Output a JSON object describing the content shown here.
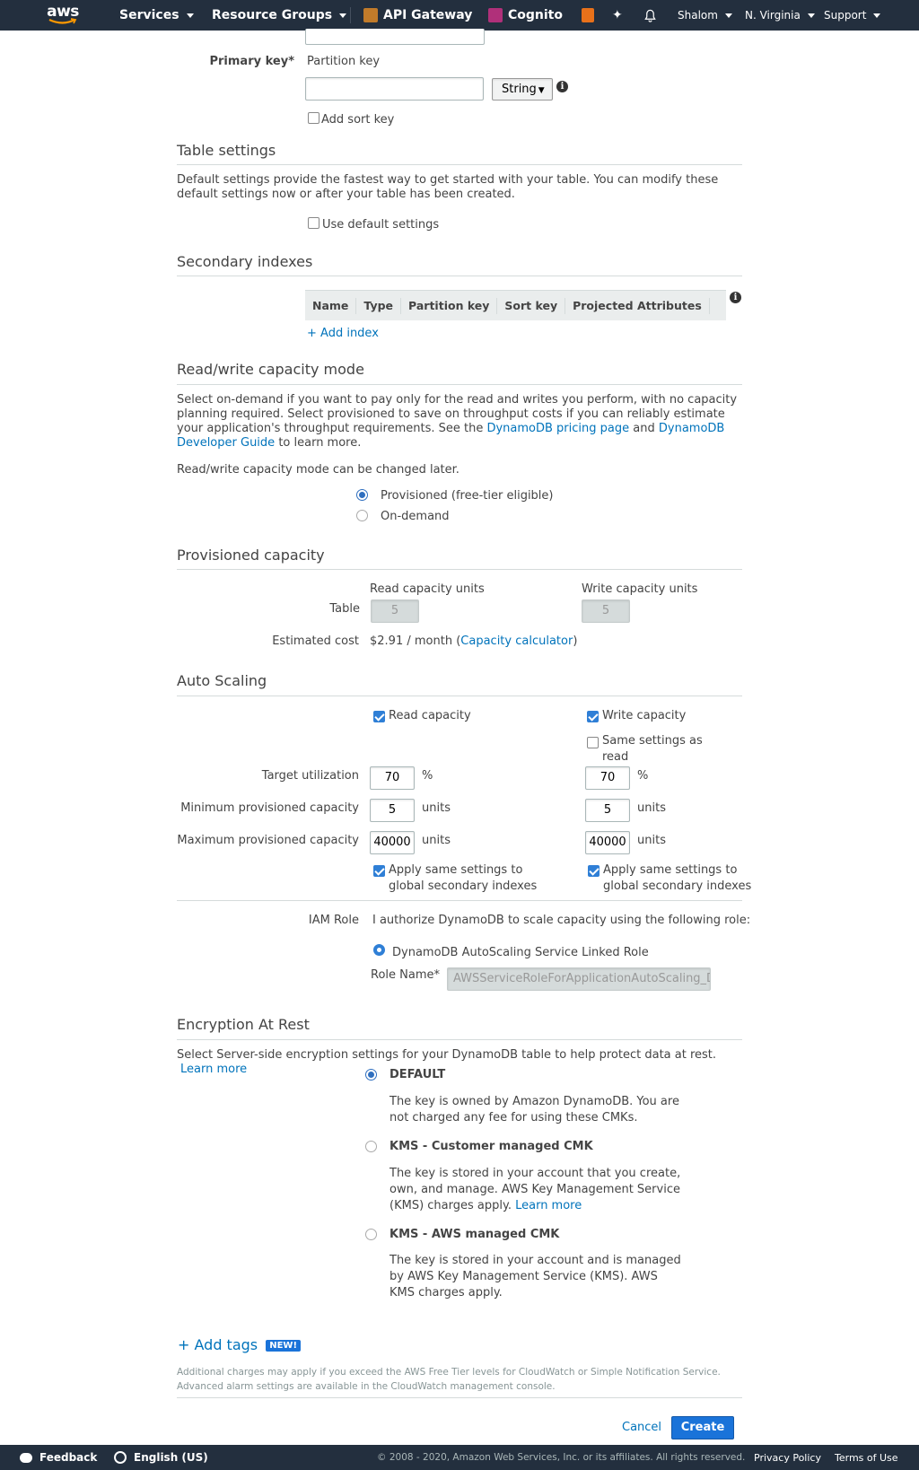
{
  "nav": {
    "logo_text": "aws",
    "services": "Services",
    "resource_groups": "Resource Groups",
    "api_gateway": "API Gateway",
    "cognito": "Cognito",
    "user": "Shalom",
    "region": "N. Virginia",
    "support": "Support"
  },
  "primary_key": {
    "label": "Primary key*",
    "partition_label": "Partition key",
    "partition_value": "",
    "type_value": "String",
    "add_sort_key": "Add sort key"
  },
  "table_settings": {
    "title": "Table settings",
    "description": "Default settings provide the fastest way to get started with your table. You can modify these default settings now or after your table has been created.",
    "use_default": "Use default settings"
  },
  "secondary_indexes": {
    "title": "Secondary indexes",
    "columns": [
      "Name",
      "Type",
      "Partition key",
      "Sort key",
      "Projected Attributes"
    ],
    "add_index": "+ Add index"
  },
  "capacity_mode": {
    "title": "Read/write capacity mode",
    "desc_part1": "Select on-demand if you want to pay only for the read and writes you perform, with no capacity planning required. Select provisioned to save on throughput costs if you can reliably estimate your application's throughput requirements. See the",
    "pricing_link": "DynamoDB pricing page",
    "and": "and",
    "guide_link": "DynamoDB Developer Guide",
    "desc_part2": "to learn more.",
    "change_later": "Read/write capacity mode can be changed later.",
    "provisioned": "Provisioned (free-tier eligible)",
    "on_demand": "On-demand"
  },
  "provisioned_capacity": {
    "title": "Provisioned capacity",
    "read_units_label": "Read capacity units",
    "write_units_label": "Write capacity units",
    "table_label": "Table",
    "read_value": "5",
    "write_value": "5",
    "estimated_cost_label": "Estimated cost",
    "cost": "$2.91 / month",
    "calc_open": "(",
    "calculator_link": "Capacity calculator",
    "calc_close": ")"
  },
  "auto_scaling": {
    "title": "Auto Scaling",
    "read_capacity": "Read capacity",
    "write_capacity": "Write capacity",
    "same_settings_line1": "Same settings as",
    "same_settings_line2": "read",
    "target_label": "Target utilization",
    "min_label": "Minimum provisioned capacity",
    "max_label": "Maximum provisioned capacity",
    "read_target": "70",
    "write_target": "70",
    "read_min": "5",
    "write_min": "5",
    "read_max": "40000",
    "write_max": "40000",
    "percent": "%",
    "units": "units",
    "apply_line1": "Apply same settings to",
    "apply_line2": "global secondary indexes",
    "iam_label": "IAM Role",
    "iam_desc": "I authorize DynamoDB to scale capacity using the following role:",
    "linked_role": "DynamoDB AutoScaling Service Linked Role",
    "role_name_label": "Role Name*",
    "role_name_value": "AWSServiceRoleForApplicationAutoScaling_D"
  },
  "encryption": {
    "title": "Encryption At Rest",
    "desc": "Select Server-side encryption settings for your DynamoDB table to help protect data at rest.",
    "learn_more": "Learn more",
    "default_title": "DEFAULT",
    "default_desc_1": "The key is owned by Amazon DynamoDB. You are",
    "default_desc_2": "not charged any fee for using these CMKs.",
    "kms_customer_title": "KMS - Customer managed CMK",
    "kms_customer_desc_1": "The key is stored in your account that you create,",
    "kms_customer_desc_2": "own, and manage. AWS Key Management Service",
    "kms_customer_desc_3": "(KMS) charges apply.",
    "kms_customer_learn": "Learn more",
    "kms_aws_title": "KMS - AWS managed CMK",
    "kms_aws_desc_1": "The key is stored in your account and is managed",
    "kms_aws_desc_2": "by AWS Key Management Service (KMS). AWS",
    "kms_aws_desc_3": "KMS charges apply."
  },
  "tags": {
    "add_tags": "+ Add tags",
    "new_badge": "NEW!",
    "note_1": "Additional charges may apply if you exceed the AWS Free Tier levels for CloudWatch or Simple Notification Service.",
    "note_2": "Advanced alarm settings are available in the CloudWatch management console."
  },
  "actions": {
    "cancel": "Cancel",
    "create": "Create"
  },
  "footer": {
    "feedback": "Feedback",
    "language": "English (US)",
    "copyright": "© 2008 - 2020, Amazon Web Services, Inc. or its affiliates. All rights reserved.",
    "privacy": "Privacy Policy",
    "terms": "Terms of Use"
  },
  "colors": {
    "nav_bg": "#232f3e",
    "link": "#0073bb",
    "primary_button": "#1a73d9"
  }
}
